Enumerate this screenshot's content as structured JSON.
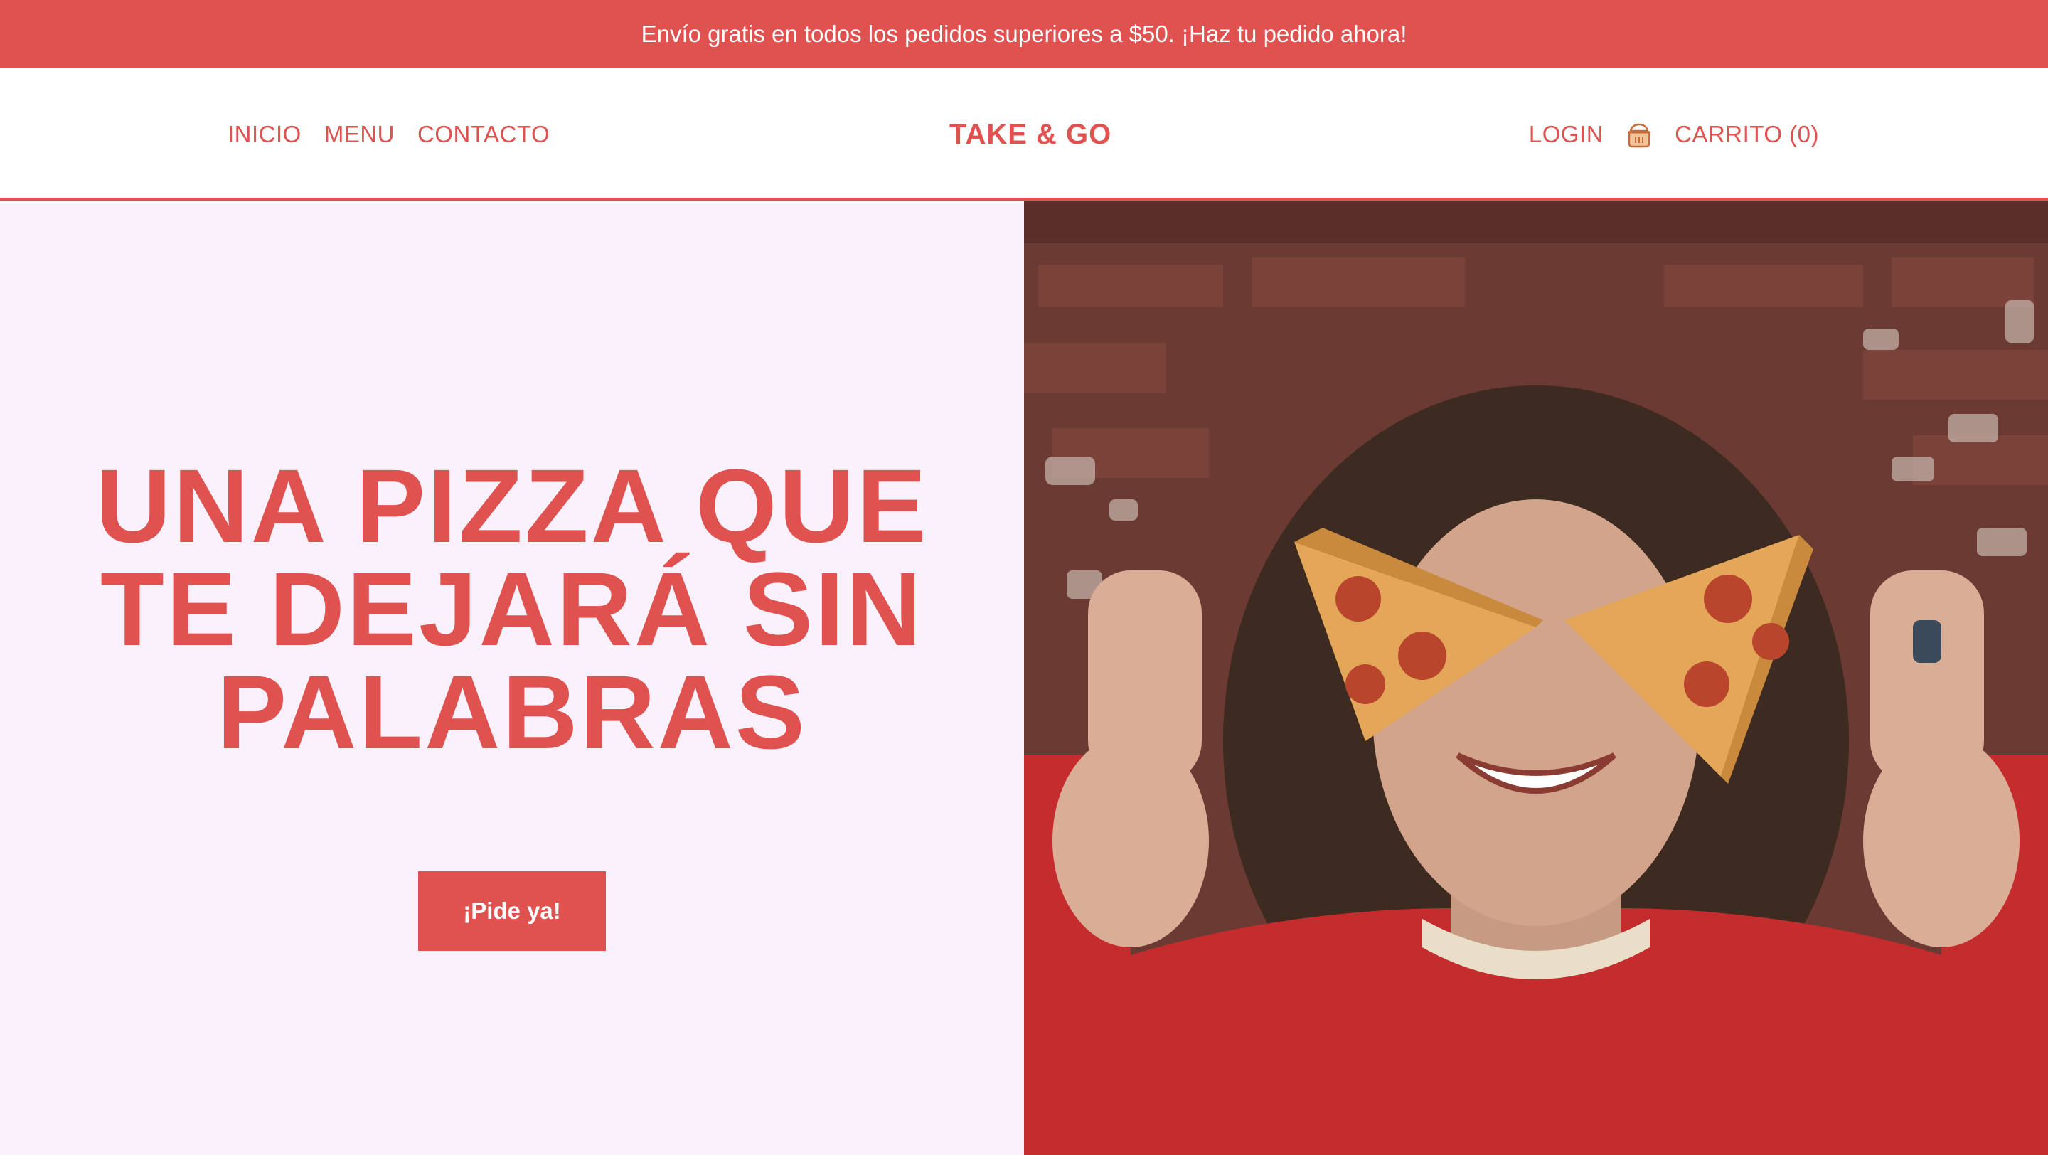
{
  "announcement": {
    "text": "Envío gratis en todos los pedidos superiores a $50. ¡Haz tu pedido ahora!"
  },
  "nav": {
    "left": [
      {
        "label": "INICIO"
      },
      {
        "label": "MENU"
      },
      {
        "label": "CONTACTO"
      }
    ],
    "brand": "TAKE & GO",
    "login": "LOGIN",
    "cart_icon": "basket-icon",
    "cart_label": "CARRITO (0)"
  },
  "hero": {
    "headline": "UNA PIZZA QUE TE DEJARÁ SIN PALABRAS",
    "cta": "¡Pide ya!",
    "image": "smiling person holding pizza slices over eyes"
  },
  "colors": {
    "accent": "#e0524f",
    "hero_bg": "#faf1fc",
    "cart_icon": "#e8a96b"
  }
}
